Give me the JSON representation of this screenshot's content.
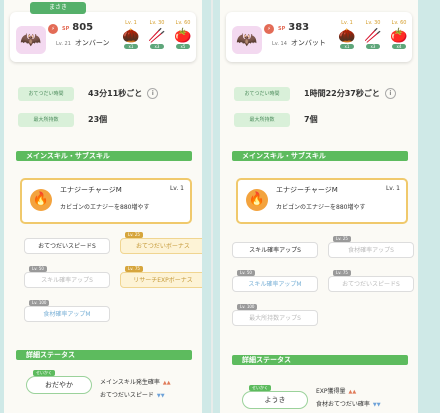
{
  "left": {
    "ribbon": "まさき",
    "sp_label": "SP",
    "sp_value": "805",
    "level": "Lv. 21",
    "name": "オンバーン",
    "ingredients": [
      {
        "lv": "Lv. 1",
        "count": "x1"
      },
      {
        "lv": "Lv. 30",
        "count": "x3"
      },
      {
        "lv": "Lv. 60",
        "count": "x5"
      }
    ],
    "helper_label": "おてつだい時間",
    "helper_value": "43分11秒ごと",
    "capacity_label": "最大所持数",
    "capacity_value": "23個",
    "skill_section": "メインスキル・サブスキル",
    "skill_name": "エナジーチャージM",
    "skill_lv": "Lv. 1",
    "skill_desc": "カビゴンのエナジーを880増やす",
    "subskills": [
      {
        "tag": "",
        "label": "おてつだいスピードS"
      },
      {
        "tag": "Lv. 25",
        "label": "おてつだいボーナス"
      },
      {
        "tag": "Lv. 50",
        "label": "スキル確率アップS"
      },
      {
        "tag": "Lv. 75",
        "label": "リサーチEXPボーナス"
      },
      {
        "tag": "Lv. 100",
        "label": "食材確率アップM"
      }
    ],
    "detail_section": "詳細ステータス",
    "nature_tag": "せいかく",
    "nature": "おだやか",
    "effects": [
      {
        "label": "メインスキル発生確率",
        "dir": "up"
      },
      {
        "label": "おてつだいスピード",
        "dir": "down"
      }
    ]
  },
  "right": {
    "ribbon": "",
    "sp_label": "SP",
    "sp_value": "383",
    "level": "Lv. 14",
    "name": "オンバット",
    "ingredients": [
      {
        "lv": "Lv. 1",
        "count": "x1"
      },
      {
        "lv": "Lv. 30",
        "count": "x3"
      },
      {
        "lv": "Lv. 60",
        "count": "x4"
      }
    ],
    "helper_label": "おてつだい時間",
    "helper_value": "1時間22分37秒ごと",
    "capacity_label": "最大所持数",
    "capacity_value": "7個",
    "skill_section": "メインスキル・サブスキル",
    "skill_name": "エナジーチャージM",
    "skill_lv": "Lv. 1",
    "skill_desc": "カビゴンのエナジーを880増やす",
    "subskills": [
      {
        "tag": "",
        "label": "スキル確率アップS"
      },
      {
        "tag": "Lv. 25",
        "label": "食材確率アップS"
      },
      {
        "tag": "Lv. 50",
        "label": "スキル確率アップM"
      },
      {
        "tag": "Lv. 75",
        "label": "おてつだいスピードS"
      },
      {
        "tag": "Lv. 100",
        "label": "最大所持数アップS"
      }
    ],
    "detail_section": "詳細ステータス",
    "nature_tag": "せいかく",
    "nature": "ようき",
    "effects": [
      {
        "label": "EXP獲得量",
        "dir": "up"
      },
      {
        "label": "食材おてつだい確率",
        "dir": "down"
      }
    ]
  },
  "colors": {
    "accent": "#5dbb5e",
    "gold": "#f0c96c",
    "up": "#e07a58",
    "down": "#6ea2d8"
  },
  "info_icon": "i"
}
